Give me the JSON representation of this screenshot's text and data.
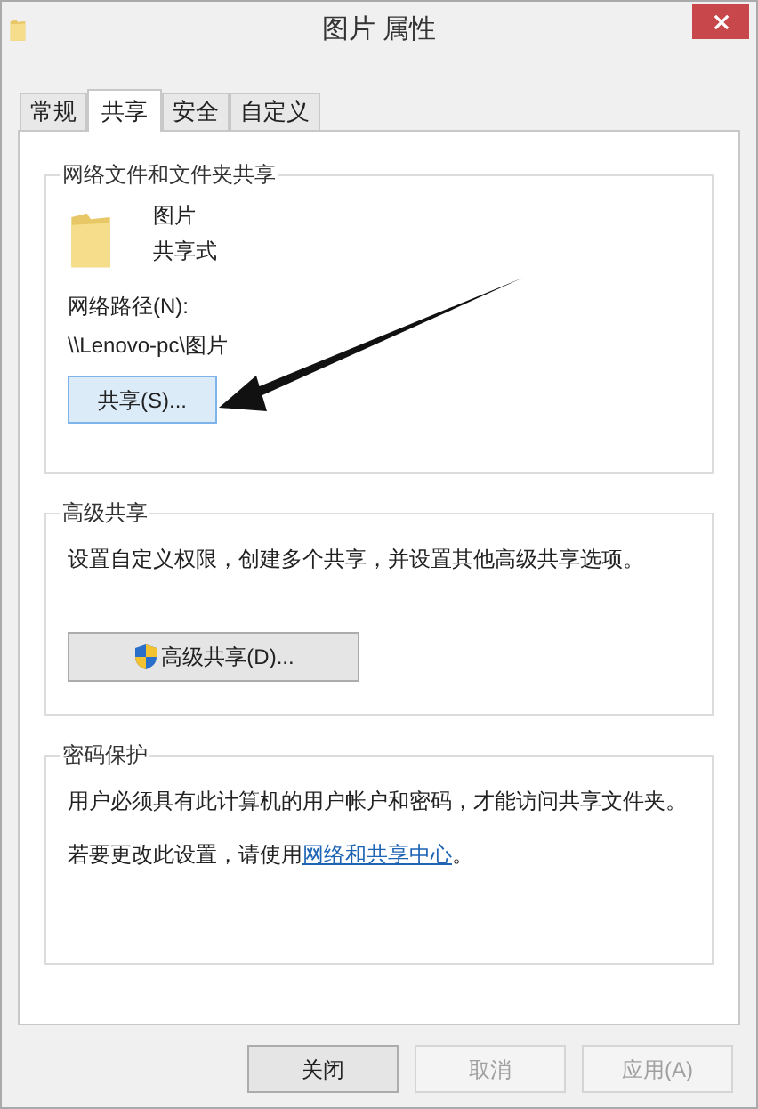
{
  "window": {
    "title": "图片 属性"
  },
  "tabs": [
    {
      "label": "常规",
      "selected": false
    },
    {
      "label": "共享",
      "selected": true
    },
    {
      "label": "安全",
      "selected": false
    },
    {
      "label": "自定义",
      "selected": false
    }
  ],
  "network_sharing": {
    "title": "网络文件和文件夹共享",
    "folder_name": "图片",
    "folder_status": "共享式",
    "path_label": "网络路径(N):",
    "path": "\\\\Lenovo-pc\\图片",
    "share_button": "共享(S)..."
  },
  "advanced_sharing": {
    "title": "高级共享",
    "description": "设置自定义权限，创建多个共享，并设置其他高级共享选项。",
    "button": "高级共享(D)..."
  },
  "password_protection": {
    "title": "密码保护",
    "description": "用户必须具有此计算机的用户帐户和密码，才能访问共享文件夹。",
    "hint": "若要更改此设置，请使用",
    "link": "网络和共享中心",
    "hint_end": "。"
  },
  "buttons": [
    {
      "label": "关闭",
      "disabled": false
    },
    {
      "label": "取消",
      "disabled": true
    },
    {
      "label": "应用(A)",
      "disabled": true
    }
  ]
}
